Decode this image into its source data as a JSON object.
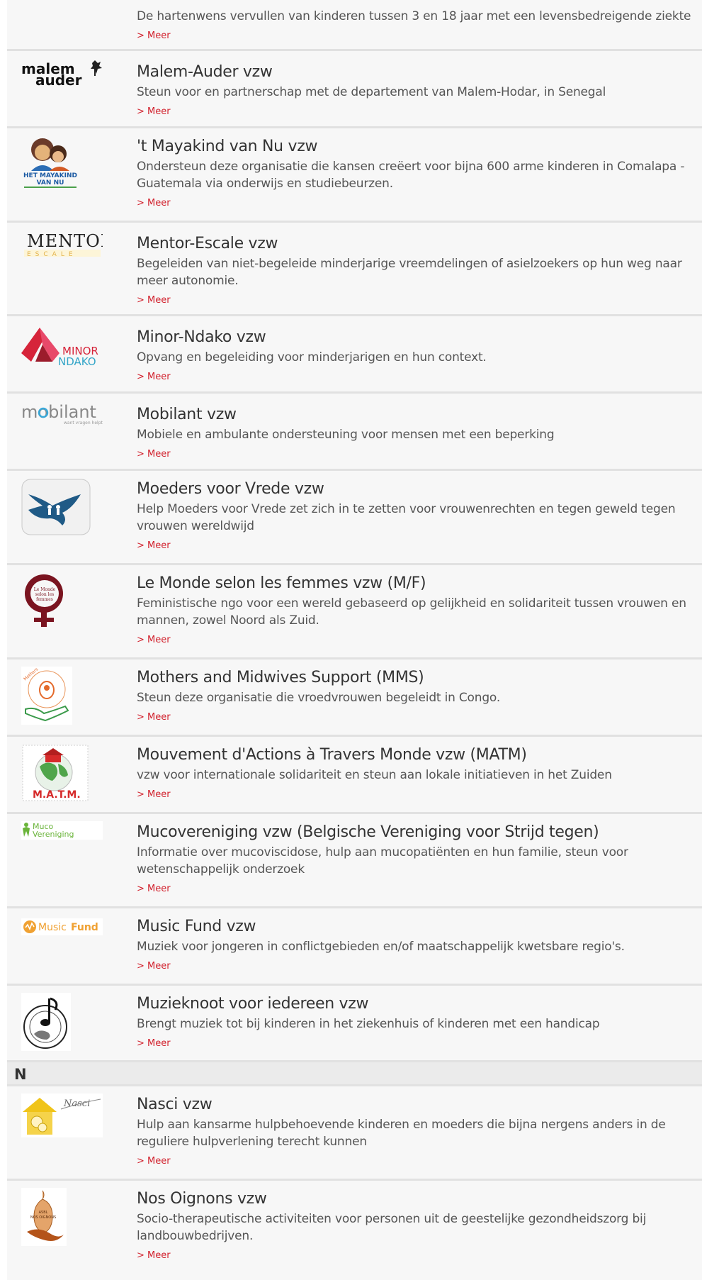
{
  "entries_top": [
    {
      "title": "",
      "desc": "De hartenwens vervullen van kinderen tussen 3 en 18 jaar met een levensbedreigende ziekte",
      "more": "> Meer"
    },
    {
      "title": "Malem-Auder vzw",
      "desc": "Steun voor en partnerschap met de departement van Malem-Hodar, in Senegal",
      "more": "> Meer",
      "logo": "malem-auder-logo",
      "logo_text": [
        "malem",
        "auder"
      ]
    },
    {
      "title": "'t Mayakind van Nu vzw",
      "desc": "Ondersteun deze organisatie die kansen creëert voor bijna 600 arme kinderen in Comalapa - Guatemala via onderwijs en studiebeurzen.",
      "more": "> Meer",
      "logo": "mayakind-logo",
      "logo_text": [
        "HET MAYAKIND",
        "VAN NU"
      ]
    },
    {
      "title": "Mentor-Escale vzw",
      "desc": "Begeleiden van niet-begeleide minderjarige vreemdelingen of asielzoekers op hun weg naar meer autonomie.",
      "more": "> Meer",
      "logo": "mentor-escale-logo",
      "logo_text": [
        "MENTOR",
        "E S C A L E"
      ]
    },
    {
      "title": "Minor-Ndako vzw",
      "desc": "Opvang en begeleiding voor minderjarigen en hun context.",
      "more": "> Meer",
      "logo": "minor-ndako-logo",
      "logo_text": [
        "MINOR",
        "NDAKO"
      ]
    },
    {
      "title": "Mobilant vzw",
      "desc": "Mobiele en ambulante ondersteuning voor mensen met een beperking",
      "more": "> Meer",
      "logo": "mobilant-logo",
      "logo_text": [
        "mobilant",
        "want vragen helpt"
      ]
    },
    {
      "title": "Moeders voor Vrede vzw",
      "desc": "Help Moeders voor Vrede zet zich in te zetten voor vrouwenrechten en tegen geweld tegen vrouwen wereldwijd",
      "more": "> Meer",
      "logo": "moeders-voor-vrede-logo"
    },
    {
      "title": "Le Monde selon les femmes vzw (M/F)",
      "desc": "Feministische ngo voor een wereld gebaseerd op gelijkheid en solidariteit tussen vrouwen en mannen, zowel Noord als Zuid.",
      "more": "> Meer",
      "logo": "monde-selon-femmes-logo",
      "logo_text": [
        "Le Monde",
        "selon les",
        "femmes"
      ]
    },
    {
      "title": "Mothers and Midwives Support (MMS)",
      "desc": "Steun deze organisatie die vroedvrouwen begeleidt in Congo.",
      "more": "> Meer",
      "logo": "mms-logo",
      "logo_text": [
        "Mothers & Midwives Support"
      ]
    },
    {
      "title": "Mouvement d'Actions à Travers Monde vzw (MATM)",
      "desc": "vzw voor internationale solidariteit en steun aan lokale initiatieven in het Zuiden",
      "more": "> Meer",
      "logo": "matm-logo",
      "logo_text": [
        "M.A.T.M."
      ]
    },
    {
      "title": "Mucovereniging vzw (Belgische Vereniging voor Strijd tegen)",
      "desc": "Informatie over mucoviscidose, hulp aan mucopatiënten en hun familie, steun voor wetenschappelijk onderzoek",
      "more": "> Meer",
      "logo": "mucovereniging-logo",
      "logo_text": [
        "Muco",
        "Vereniging"
      ]
    },
    {
      "title": "Music Fund vzw",
      "desc": "Muziek voor jongeren in conflictgebieden en/of maatschappelijk kwetsbare regio's.",
      "more": "> Meer",
      "logo": "music-fund-logo",
      "logo_text": [
        "Music",
        "Fund"
      ]
    },
    {
      "title": "Muzieknoot voor iedereen vzw",
      "desc": "Brengt muziek tot bij kinderen in het ziekenhuis of kinderen met een handicap",
      "more": "> Meer",
      "logo": "muzieknoot-logo"
    }
  ],
  "section_n": {
    "letter": "N"
  },
  "entries_n": [
    {
      "title": "Nasci vzw",
      "desc": "Hulp aan kansarme hulpbehoevende kinderen en moeders die bijna nergens anders in de reguliere hulpverlening terecht kunnen",
      "more": "> Meer",
      "logo": "nasci-logo",
      "logo_text": [
        "Nasci"
      ]
    },
    {
      "title": "Nos Oignons vzw",
      "desc": "Socio-therapeutische activiteiten voor personen uit de geestelijke gezondheidszorg bij landbouwbedrijven.",
      "more": "> Meer",
      "logo": "nos-oignons-logo",
      "logo_text": [
        "ASBL",
        "NOS OIGNONS"
      ]
    }
  ],
  "colors": {
    "row_bg": "#f7f7f7",
    "separator": "#e1e1e1",
    "link": "#d11f2b",
    "title": "#333333",
    "text": "#555555",
    "section_bg": "#ebebeb"
  }
}
